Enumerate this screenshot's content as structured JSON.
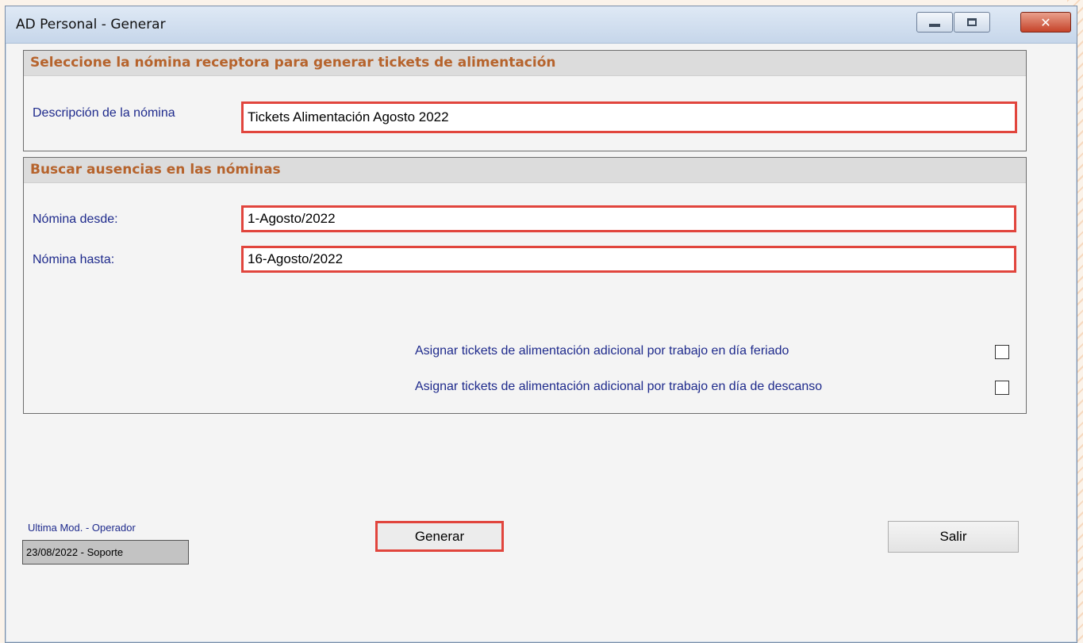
{
  "window": {
    "title": "AD Personal - Generar",
    "close_glyph": "✕"
  },
  "section_receptora": {
    "header": "Seleccione la nómina receptora para generar tickets de alimentación",
    "descripcion_label": "Descripción de la nómina",
    "descripcion_value": "Tickets Alimentación Agosto 2022"
  },
  "section_ausencias": {
    "header": "Buscar ausencias en las nóminas",
    "desde_label": "Nómina desde:",
    "desde_value": "1-Agosto/2022",
    "hasta_label": "Nómina hasta:",
    "hasta_value": "16-Agosto/2022",
    "checks": [
      {
        "label": "Asignar tickets de alimentación adicional por trabajo en día feriado",
        "checked": false
      },
      {
        "label": "Asignar tickets de alimentación adicional por trabajo en día de descanso",
        "checked": false
      }
    ]
  },
  "footer": {
    "ultima_mod_label": "Ultima Mod. - Operador",
    "ultima_mod_value": "23/08/2022 - Soporte",
    "generar_label": "Generar",
    "salir_label": "Salir"
  },
  "colors": {
    "highlight": "#e1453d",
    "section_header_text": "#b6632c",
    "label_text": "#1e2a8c"
  }
}
